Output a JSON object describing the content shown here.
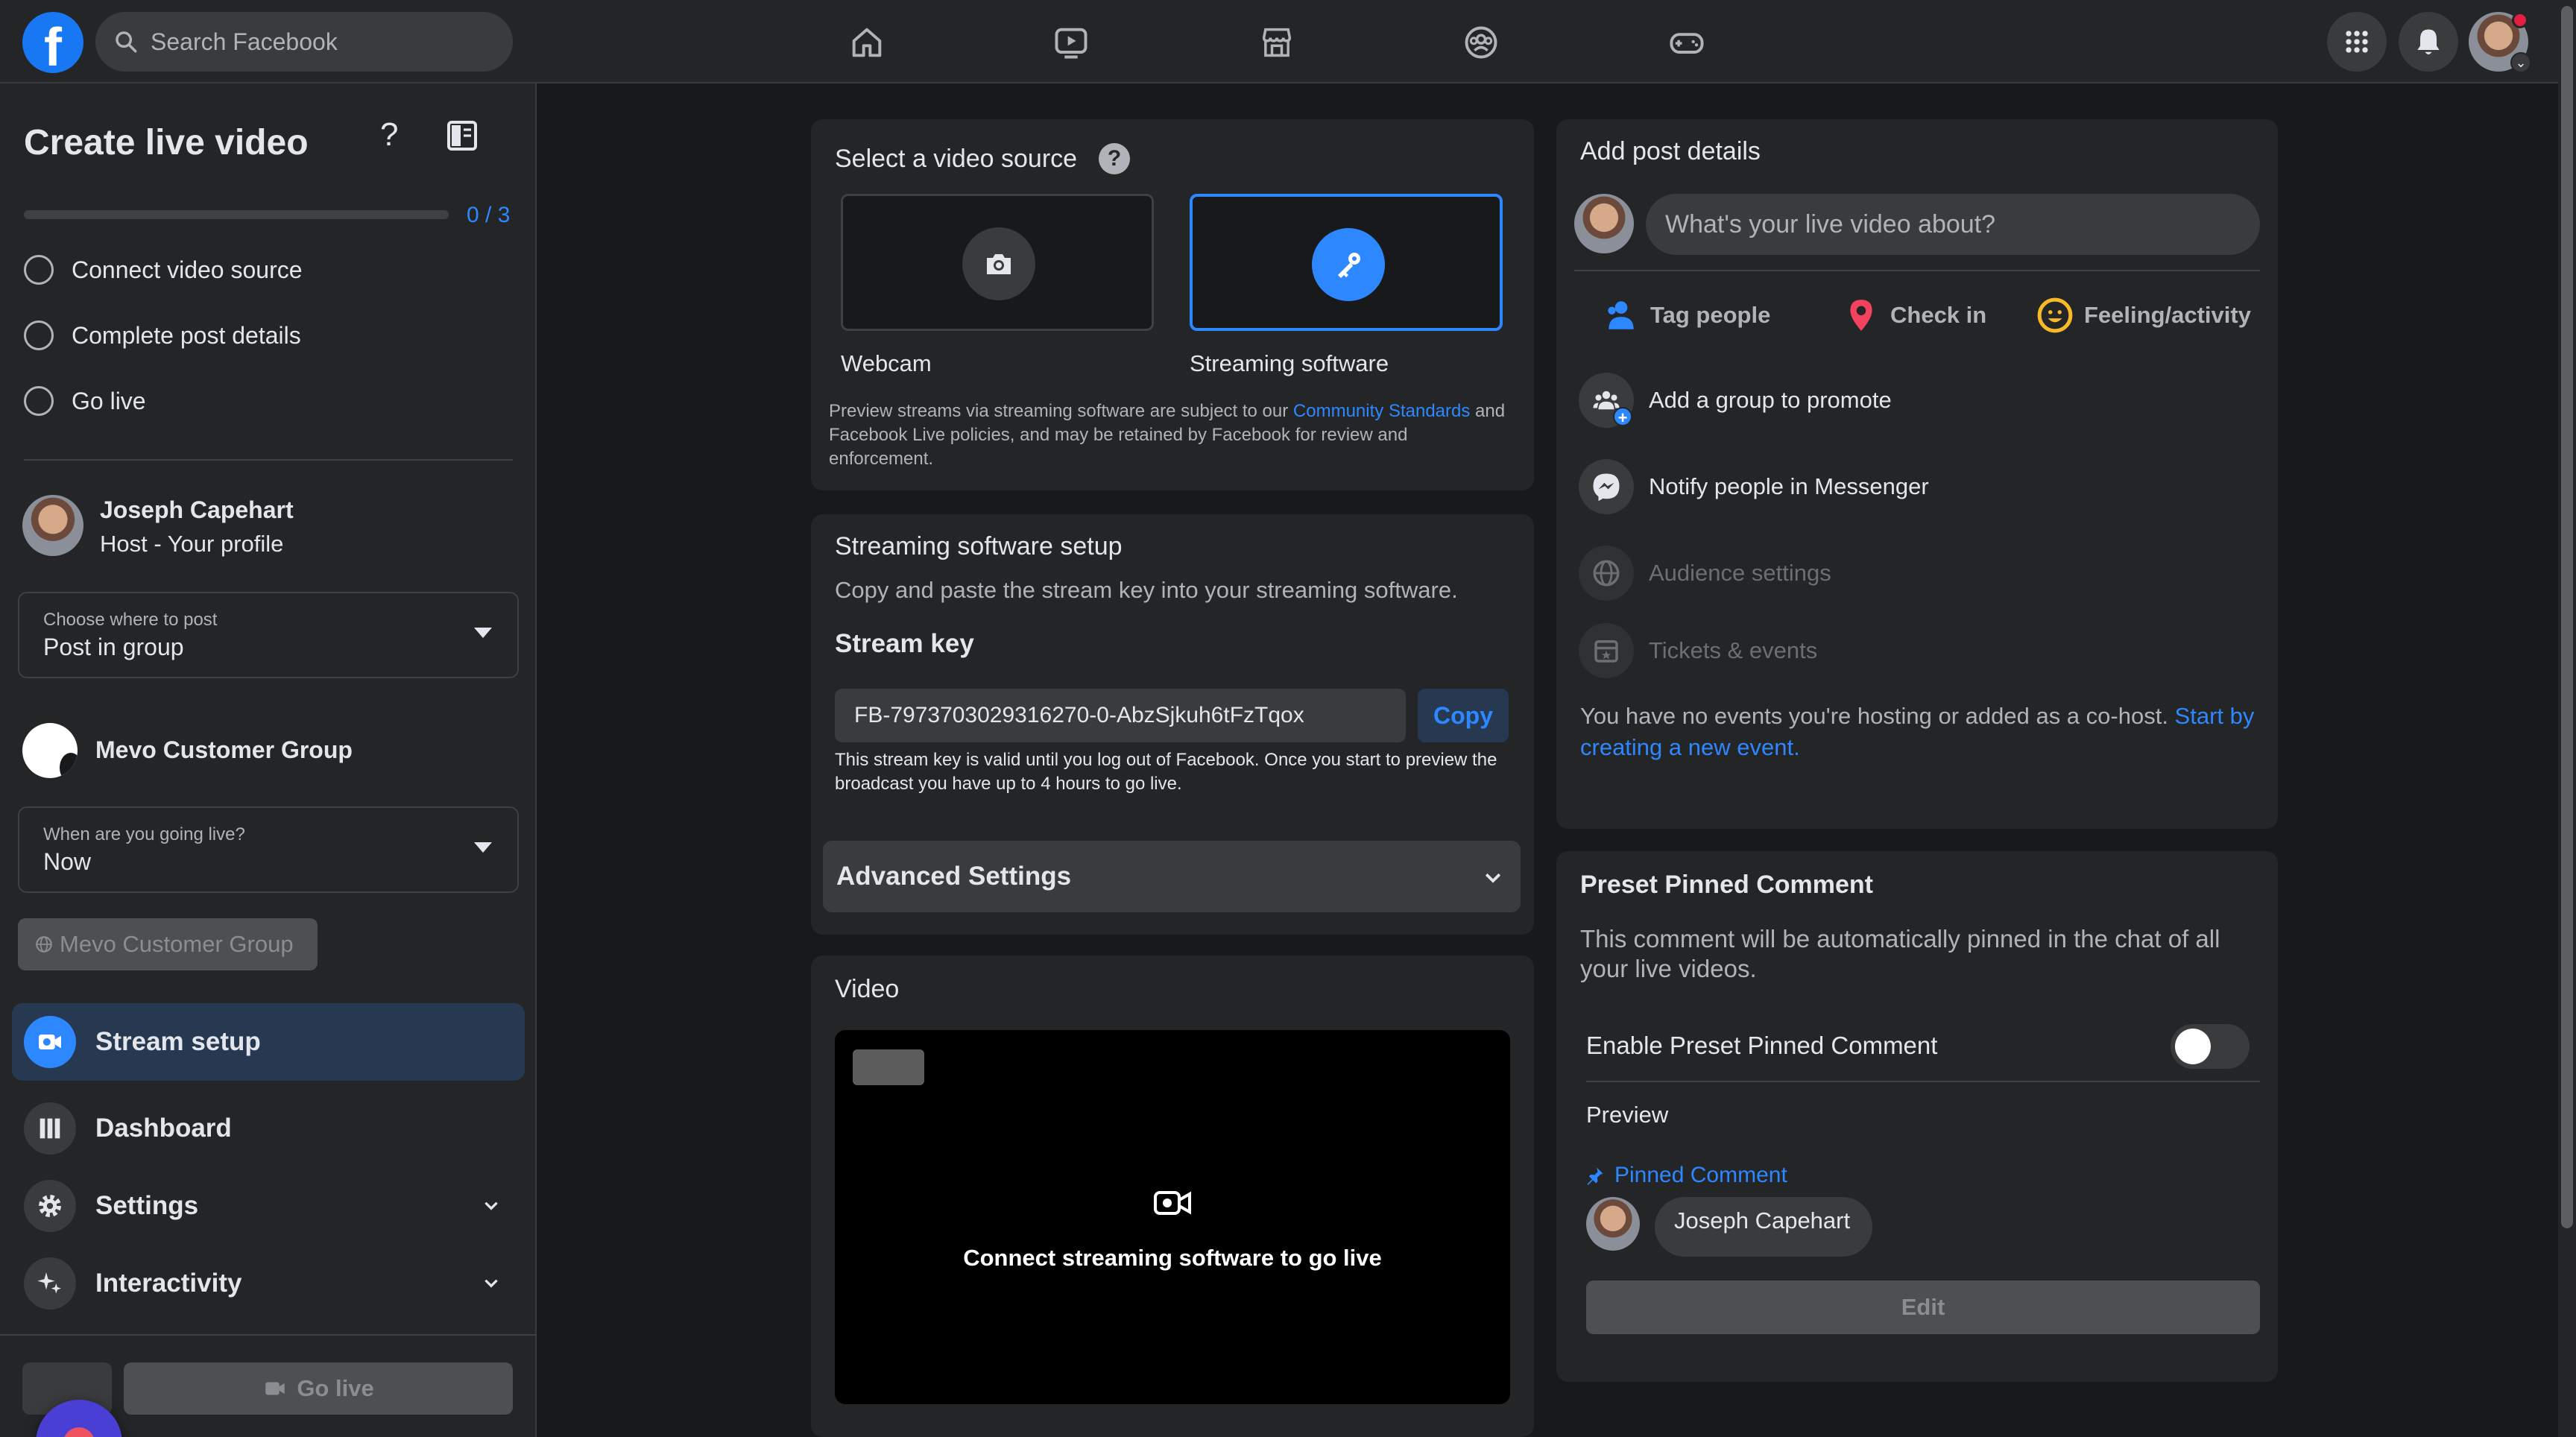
{
  "topbar": {
    "logo_letter": "f",
    "search_placeholder": "Search Facebook",
    "nav_icons": [
      "home-icon",
      "video-icon",
      "marketplace-icon",
      "groups-icon",
      "gaming-icon"
    ],
    "right_icons": [
      "menu-grid-icon",
      "notifications-icon"
    ]
  },
  "sidebar": {
    "title": "Create live video",
    "help_glyph": "?",
    "progress": {
      "completed": 0,
      "total": 3,
      "text": "0 / 3"
    },
    "steps": [
      {
        "label": "Connect video source"
      },
      {
        "label": "Complete post details"
      },
      {
        "label": "Go live"
      }
    ],
    "host": {
      "name": "Joseph Capehart",
      "role": "Host - Your profile"
    },
    "post_where": {
      "label": "Choose where to post",
      "value": "Post in group"
    },
    "group": {
      "name": "Mevo Customer Group"
    },
    "going_live": {
      "label": "When are you going live?",
      "value": "Now"
    },
    "group_chip": "Mevo Customer Group",
    "nav": [
      {
        "label": "Stream setup",
        "active": true
      },
      {
        "label": "Dashboard",
        "active": false
      },
      {
        "label": "Settings",
        "active": false
      },
      {
        "label": "Interactivity",
        "active": false
      }
    ],
    "go_live_label": "Go live"
  },
  "video_source": {
    "title": "Select a video source",
    "help_glyph": "?",
    "options": [
      {
        "label": "Webcam",
        "selected": false
      },
      {
        "label": "Streaming software",
        "selected": true
      }
    ],
    "notice_before": "Preview streams via streaming software are subject to our ",
    "notice_link": "Community Standards",
    "notice_after": " and Facebook Live policies, and may be retained by Facebook for review and enforcement."
  },
  "streaming_setup": {
    "title": "Streaming software setup",
    "subtitle": "Copy and paste the stream key into your streaming software.",
    "key_label": "Stream key",
    "key_value": "FB-7973703029316270-0-AbzSjkuh6tFzTqox",
    "copy_label": "Copy",
    "key_note": "This stream key is valid until you log out of Facebook. Once you start to preview the broadcast you have up to 4 hours to go live.",
    "advanced_label": "Advanced Settings"
  },
  "video": {
    "title": "Video",
    "message": "Connect streaming software to go live"
  },
  "post_details": {
    "title": "Add post details",
    "placeholder": "What's your live video about?",
    "actions": [
      {
        "label": "Tag people",
        "icon": "tag-people-icon",
        "color": "#2d88ff"
      },
      {
        "label": "Check in",
        "icon": "location-pin-icon",
        "color": "#f3425f"
      },
      {
        "label": "Feeling/activity",
        "icon": "smiley-icon",
        "color": "#f7b928"
      }
    ],
    "rows": [
      {
        "label": "Add a group to promote",
        "icon": "group-icon",
        "badge": "+"
      },
      {
        "label": "Notify people in Messenger",
        "icon": "messenger-icon"
      },
      {
        "label": "Audience settings",
        "icon": "globe-icon"
      },
      {
        "label": "Tickets & events",
        "icon": "ticket-icon"
      }
    ],
    "events_text": "You have no events you're hosting or added as a co-host. ",
    "events_link": "Start by creating a new event."
  },
  "pinned": {
    "title": "Preset Pinned Comment",
    "description": "This comment will be automatically pinned in the chat of all your live videos.",
    "toggle_label": "Enable Preset Pinned Comment",
    "toggle_on": false,
    "preview_label": "Preview",
    "pinned_label": "Pinned Comment",
    "commenter": "Joseph Capehart",
    "edit_label": "Edit"
  }
}
